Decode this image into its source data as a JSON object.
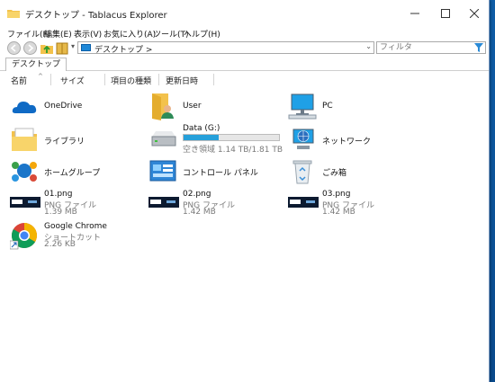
{
  "colors": {
    "accent": "#26a0da",
    "folder": "#f3c24c",
    "onedrive": "#0f6ac5"
  },
  "window": {
    "title": "デスクトップ - Tablacus Explorer"
  },
  "menu": [
    "ファイル(F)",
    "編集(E)",
    "表示(V)",
    "お気に入り(A)",
    "ツール(T)",
    "ヘルプ(H)"
  ],
  "address": {
    "path": "デスクトップ >",
    "filter_placeholder": "フィルタ"
  },
  "tab": {
    "label": "デスクトップ"
  },
  "columns": [
    "名前",
    "サイズ",
    "項目の種類",
    "更新日時"
  ],
  "items": [
    {
      "name": "OneDrive",
      "icon": "onedrive-icon"
    },
    {
      "name": "User",
      "icon": "user-folder-icon"
    },
    {
      "name": "PC",
      "icon": "pc-icon"
    },
    {
      "name": "ライブラリ",
      "icon": "library-icon"
    },
    {
      "name": "Data (G:)",
      "icon": "drive-icon",
      "sub": "空き領域 1.14 TB/1.81 TB",
      "used_fraction": 0.37
    },
    {
      "name": "ネットワーク",
      "icon": "network-icon"
    },
    {
      "name": "ホームグループ",
      "icon": "homegroup-icon"
    },
    {
      "name": "コントロール パネル",
      "icon": "control-panel-icon"
    },
    {
      "name": "ごみ箱",
      "icon": "recycle-bin-icon"
    },
    {
      "name": "01.png",
      "icon": "image-thumbnail",
      "type": "PNG ファイル",
      "size": "1.39 MB"
    },
    {
      "name": "02.png",
      "icon": "image-thumbnail",
      "type": "PNG ファイル",
      "size": "1.42 MB"
    },
    {
      "name": "03.png",
      "icon": "image-thumbnail",
      "type": "PNG ファイル",
      "size": "1.42 MB"
    },
    {
      "name": "Google Chrome",
      "icon": "chrome-icon",
      "type": "ショートカット",
      "size": "2.26 KB"
    }
  ]
}
